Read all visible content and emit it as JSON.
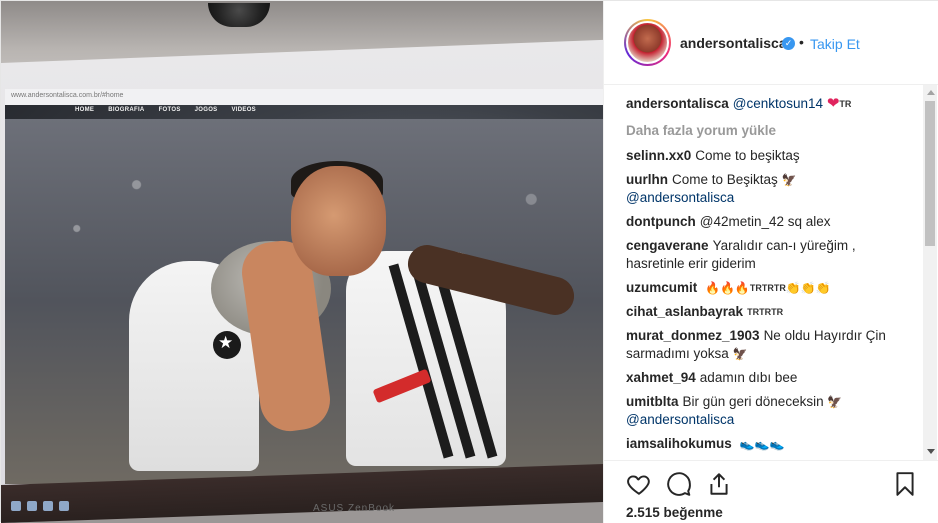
{
  "media": {
    "site_url": "www.andersontalisca.com.br/#home",
    "site_nav": [
      "HOME",
      "BIOGRAFIA",
      "FOTOS",
      "JOGOS",
      "VIDEOS"
    ],
    "monitor_brand": "ASUS ZenBook"
  },
  "header": {
    "username": "andersontalisca",
    "separator": "•",
    "follow_label": "Takip Et"
  },
  "caption": {
    "username": "andersontalisca",
    "mention": "@cenktosun14",
    "trailing": "TR"
  },
  "load_more_label": "Daha fazla yorum yükle",
  "comments": [
    {
      "username": "selinn.xx0",
      "text": "Come to beşiktaş"
    },
    {
      "username": "uurlhn",
      "text": "Come to Beşiktaş",
      "line2": "@andersontalisca"
    },
    {
      "username": "dontpunch",
      "text": "@42metin_42 sq alex"
    },
    {
      "username": "cengaverane",
      "text": "Yaralıdır can-ı yüreğim ,",
      "line2": "hasretinle erir giderim"
    },
    {
      "username": "uzumcumit",
      "text": "TRTRTR"
    },
    {
      "username": "cihat_aslanbayrak",
      "text": "TRTRTR"
    },
    {
      "username": "murat_donmez_1903",
      "text": "Ne oldu Hayırdır Çin",
      "line2": "sarmadımı yoksa"
    },
    {
      "username": "xahmet_94",
      "text": "adamın dıbı bee"
    },
    {
      "username": "umitblta",
      "text": "Bir gün geri döneceksin",
      "line2": "@andersontalisca"
    },
    {
      "username": "iamsalihokumus",
      "text": ""
    }
  ],
  "likes": "2.515 beğenme",
  "icons": {
    "like": "heart-outline-icon",
    "comment": "comment-icon",
    "share": "share-icon",
    "save": "bookmark-icon",
    "verified": "verified-badge-icon"
  },
  "colors": {
    "accent": "#3897f0",
    "text": "#262626",
    "muted": "#999999",
    "mention": "#003569"
  }
}
